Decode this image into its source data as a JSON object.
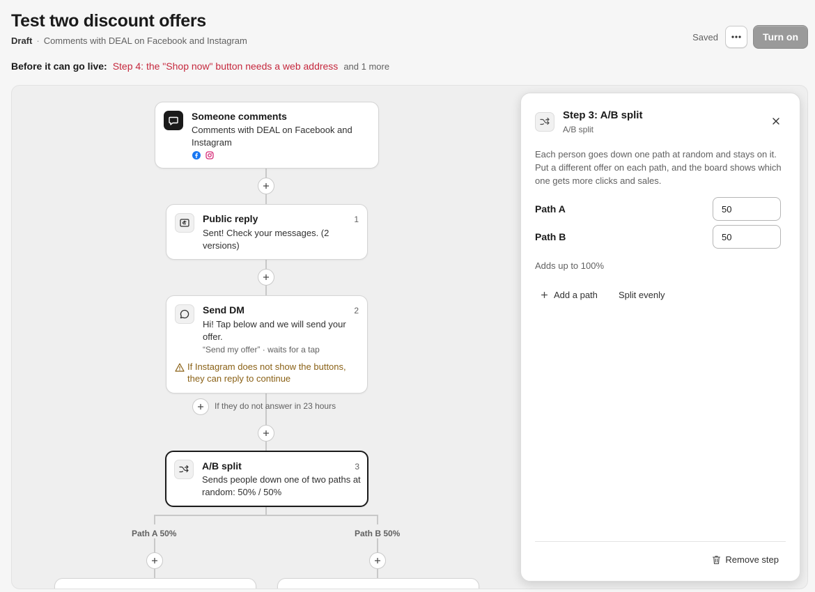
{
  "header": {
    "title": "Test two discount offers",
    "status": "Draft",
    "description": "Comments with DEAL on Facebook and Instagram",
    "saved_label": "Saved",
    "more_button_icon": "more-horizontal-icon",
    "turn_on_label": "Turn on"
  },
  "golive": {
    "label": "Before it can go live:",
    "error": "Step 4: the \"Shop now\" button needs a web address",
    "more": "and 1 more"
  },
  "flow": {
    "trigger": {
      "title": "Someone comments",
      "description": "Comments with DEAL on Facebook and Instagram",
      "icon": "comment-icon",
      "channels": [
        "facebook-icon",
        "instagram-icon"
      ]
    },
    "steps": [
      {
        "title": "Public reply",
        "number": "1",
        "description": "Sent! Check your messages. (2 versions)",
        "icon": "reply-icon"
      },
      {
        "title": "Send DM",
        "number": "2",
        "description": "Hi! Tap below and we will send your offer.",
        "meta": "“Send my offer” · waits for a tap",
        "warning": "If Instagram does not show the buttons, they can reply to continue",
        "icon": "message-icon"
      },
      {
        "title": "A/B split",
        "number": "3",
        "description": "Sends people down one of two paths at random: 50% / 50%",
        "icon": "shuffle-icon"
      }
    ],
    "timeout_label": "If they do not answer in 23 hours",
    "paths": [
      {
        "label": "Path A 50%"
      },
      {
        "label": "Path B 50%"
      }
    ]
  },
  "panel": {
    "title": "Step 3: A/B split",
    "subtitle": "A/B split",
    "description": "Each person goes down one path at random and stays on it. Put a different offer on each path, and the board shows which one gets more clicks and sales.",
    "paths": [
      {
        "label": "Path A",
        "value": "50"
      },
      {
        "label": "Path B",
        "value": "50"
      }
    ],
    "total_note": "Adds up to 100%",
    "add_path_label": "Add a path",
    "split_evenly_label": "Split evenly",
    "remove_label": "Remove step"
  },
  "colors": {
    "error": "#c5283d",
    "warning": "#8a6116",
    "facebook": "#1877f2",
    "instagram": "#d62976",
    "disabled_button": "#9a9a9a"
  }
}
